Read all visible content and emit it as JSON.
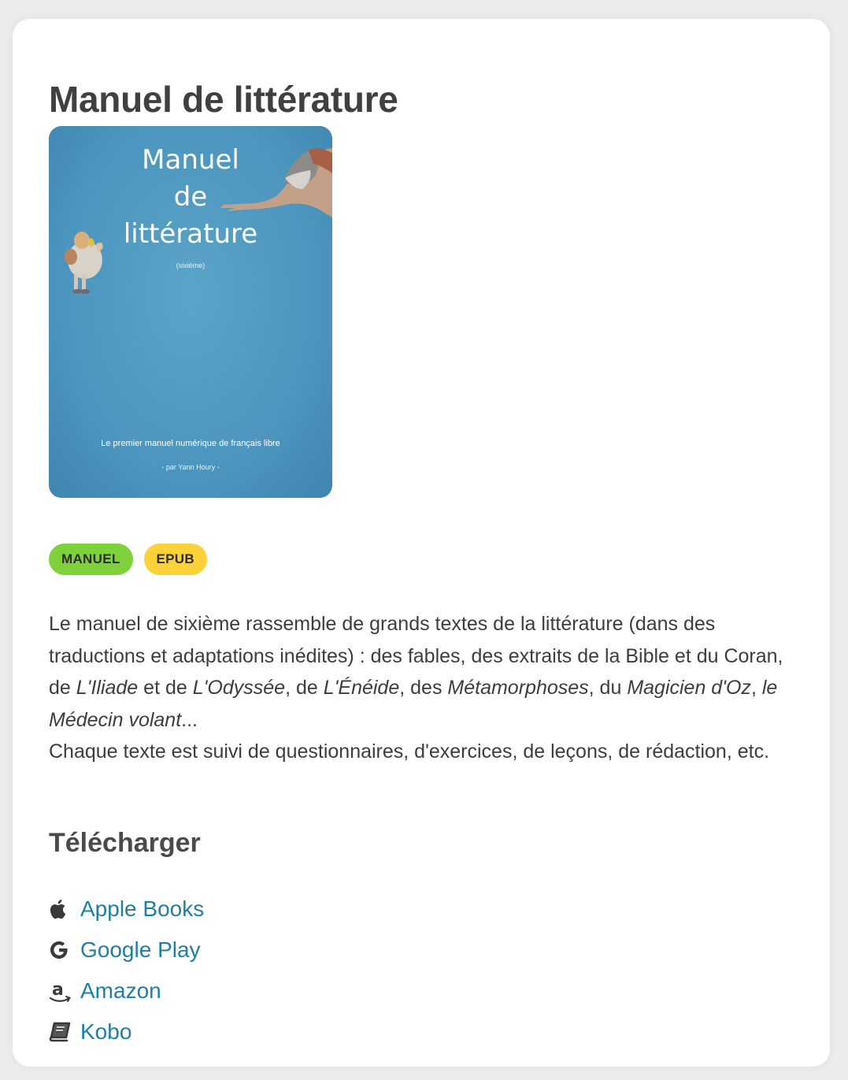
{
  "page": {
    "title": "Manuel de littérature"
  },
  "cover": {
    "title_line1": "Manuel",
    "title_line2": "de",
    "title_line3": "littérature",
    "subtitle": "(sixième)",
    "tagline": "Le premier manuel numérique de français libre",
    "author": "- par Yann Houry -",
    "background_color": "#4c96bf"
  },
  "tags": [
    {
      "label": "MANUEL",
      "color": "#7fd13b"
    },
    {
      "label": "EPUB",
      "color": "#fdd138"
    }
  ],
  "description": {
    "p1_a": "Le manuel de sixième rassemble de grands textes de la littérature (dans des traductions et adaptations inédites) : des fables, des extraits de la Bible et du Coran, de ",
    "iliade": "L'Iliade",
    "p1_b": " et de ",
    "odyssee": "L'Odyssée",
    "p1_c": ", de ",
    "eneide": "L'Énéide",
    "p1_d": ", des ",
    "metamorphoses": "Métamorphoses",
    "p1_e": ", du ",
    "magicien": "Magicien d'Oz",
    "p1_f": ", ",
    "medecin": "le Médecin volant",
    "p1_g": "...",
    "p2": "Chaque texte est suivi de questionnaires, d'exercices, de leçons, de rédaction, etc."
  },
  "download": {
    "heading": "Télécharger",
    "links": [
      {
        "label": "Apple Books",
        "icon": "apple-icon"
      },
      {
        "label": "Google Play",
        "icon": "google-icon"
      },
      {
        "label": "Amazon",
        "icon": "amazon-icon"
      },
      {
        "label": "Kobo",
        "icon": "book-icon"
      }
    ]
  },
  "colors": {
    "link": "#1f7fa3",
    "text": "#3d3d3d"
  }
}
